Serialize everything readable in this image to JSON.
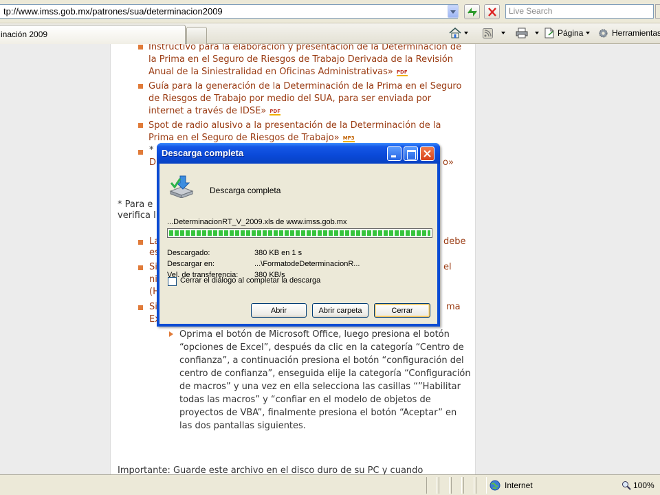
{
  "browser": {
    "url": "tp://www.imss.gob.mx/patrones/sua/determinacion2009",
    "search_placeholder": "Live Search",
    "tab_title": "inación 2009",
    "toolbar": {
      "home_icon": "home-icon",
      "feeds_icon": "rss-icon",
      "print_icon": "printer-icon",
      "page_label": "Página",
      "tools_label": "Herramientas"
    },
    "status": {
      "zone": "Internet",
      "zoom": "100%"
    }
  },
  "content": {
    "list_items": [
      {
        "text": "Instructivo para la elaboración y presentación de la Determinación de la Prima en el Seguro de Riesgos de Trabajo Derivada de la Revisión Anual de la Siniestralidad en Oficinas Administrativas»",
        "badge": "PDF"
      },
      {
        "text": "Guía para la generación de la Determinación de la Prima en el Seguro de Riesgos de Trabajo por medio del SUA, para ser enviada por internet a través de IDSE»",
        "badge": "PDF"
      },
      {
        "text": "Spot de radio alusivo a la presentación de la Determinación de la Prima en el Seguro de Riesgos de Trabajo»",
        "badge": "MP3"
      }
    ],
    "frag_star": "*",
    "frag_d": "D",
    "frag_o": "o»",
    "frag_para": "* Para e",
    "frag_verifica": "verifica l",
    "frag_la": "La",
    "frag_es": "es",
    "frag_debe": "debe",
    "frag_si1": "Si",
    "frag_ni": "ni",
    "frag_h": "(H",
    "frag_el": "el",
    "frag_si2": "Si",
    "frag_ex": "Ex",
    "frag_ma": "ma",
    "steps_text": "Oprima el botón de Microsoft Office, luego presiona el botón “opciones de Excel”, después da clic en la categoría “Centro de confianza”, a continuación presiona el botón “configuración del centro de confianza”, enseguida elije la categoría “Configuración de macros” y una vez en ella selecciona las casillas “”Habilitar todas las macros” y “confiar en el modelo de objetos de proyectos de VBA”, finalmente presiona el botón “Aceptar” en las dos pantallas siguientes.",
    "important_text": "Importante: Guarde este archivo en el disco duro de su PC y cuando"
  },
  "dialog": {
    "title": "Descarga completa",
    "heading": "Descarga completa",
    "file_line": "...DeterminacionRT_V_2009.xls de www.imss.gob.mx",
    "progress": 1.0,
    "rows": [
      {
        "label": "Descargado:",
        "value": "380 KB en 1 s"
      },
      {
        "label": "Descargar en:",
        "value": "...\\FormatodeDeterminacionR..."
      },
      {
        "label": "Vel. de transferencia:",
        "value": "380 KB/s"
      }
    ],
    "checkbox_label": "Cerrar el diálogo al completar la descarga",
    "checkbox_checked": false,
    "buttons": {
      "open": "Abrir",
      "open_folder": "Abrir carpeta",
      "close": "Cerrar"
    }
  },
  "colors": {
    "link": "#9a3b12",
    "bullet": "#e07b39",
    "xp_blue": "#0a4bd3",
    "progress_green": "#37c43d"
  }
}
